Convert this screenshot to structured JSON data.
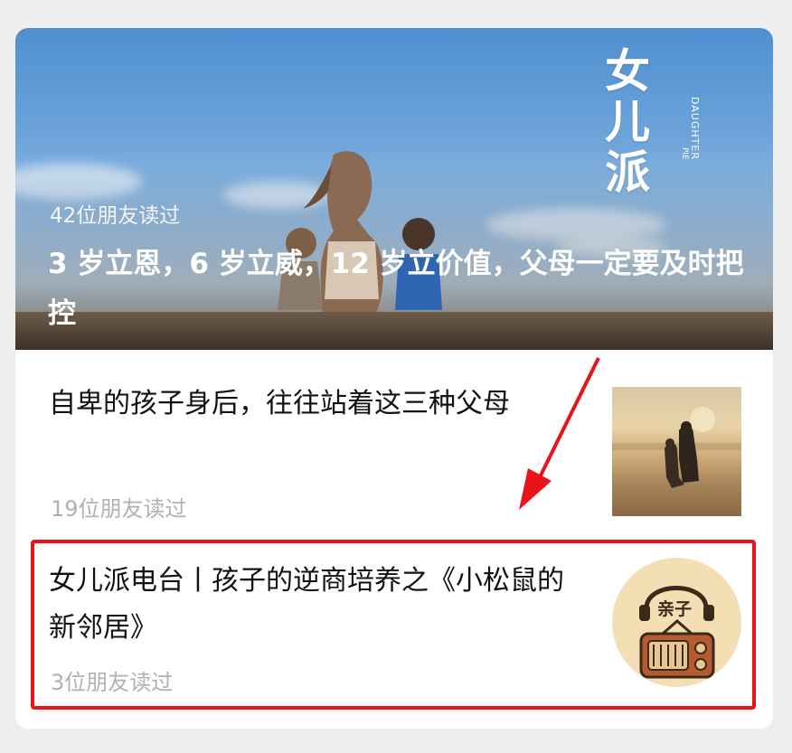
{
  "hero": {
    "logo": "女儿派",
    "logo_en": "DAUGHTER",
    "logo_en2": "PIE",
    "readers": "42位朋友读过",
    "title": "3 岁立恩，6 岁立威，12 岁立价值，父母一定要及时把控"
  },
  "articles": [
    {
      "headline": "自卑的孩子身后，往往站着这三种父母",
      "readers": "19位朋友读过",
      "thumb_icon": "sunset-family-photo"
    },
    {
      "headline": "女儿派电台丨孩子的逆商培养之《小松鼠的新邻居》",
      "readers": "3位朋友读过",
      "thumb_icon": "radio-parenting-icon",
      "thumb_label": "亲子"
    }
  ],
  "colors": {
    "highlight": "#e8141a",
    "reader_gray": "#b1b1b1"
  }
}
